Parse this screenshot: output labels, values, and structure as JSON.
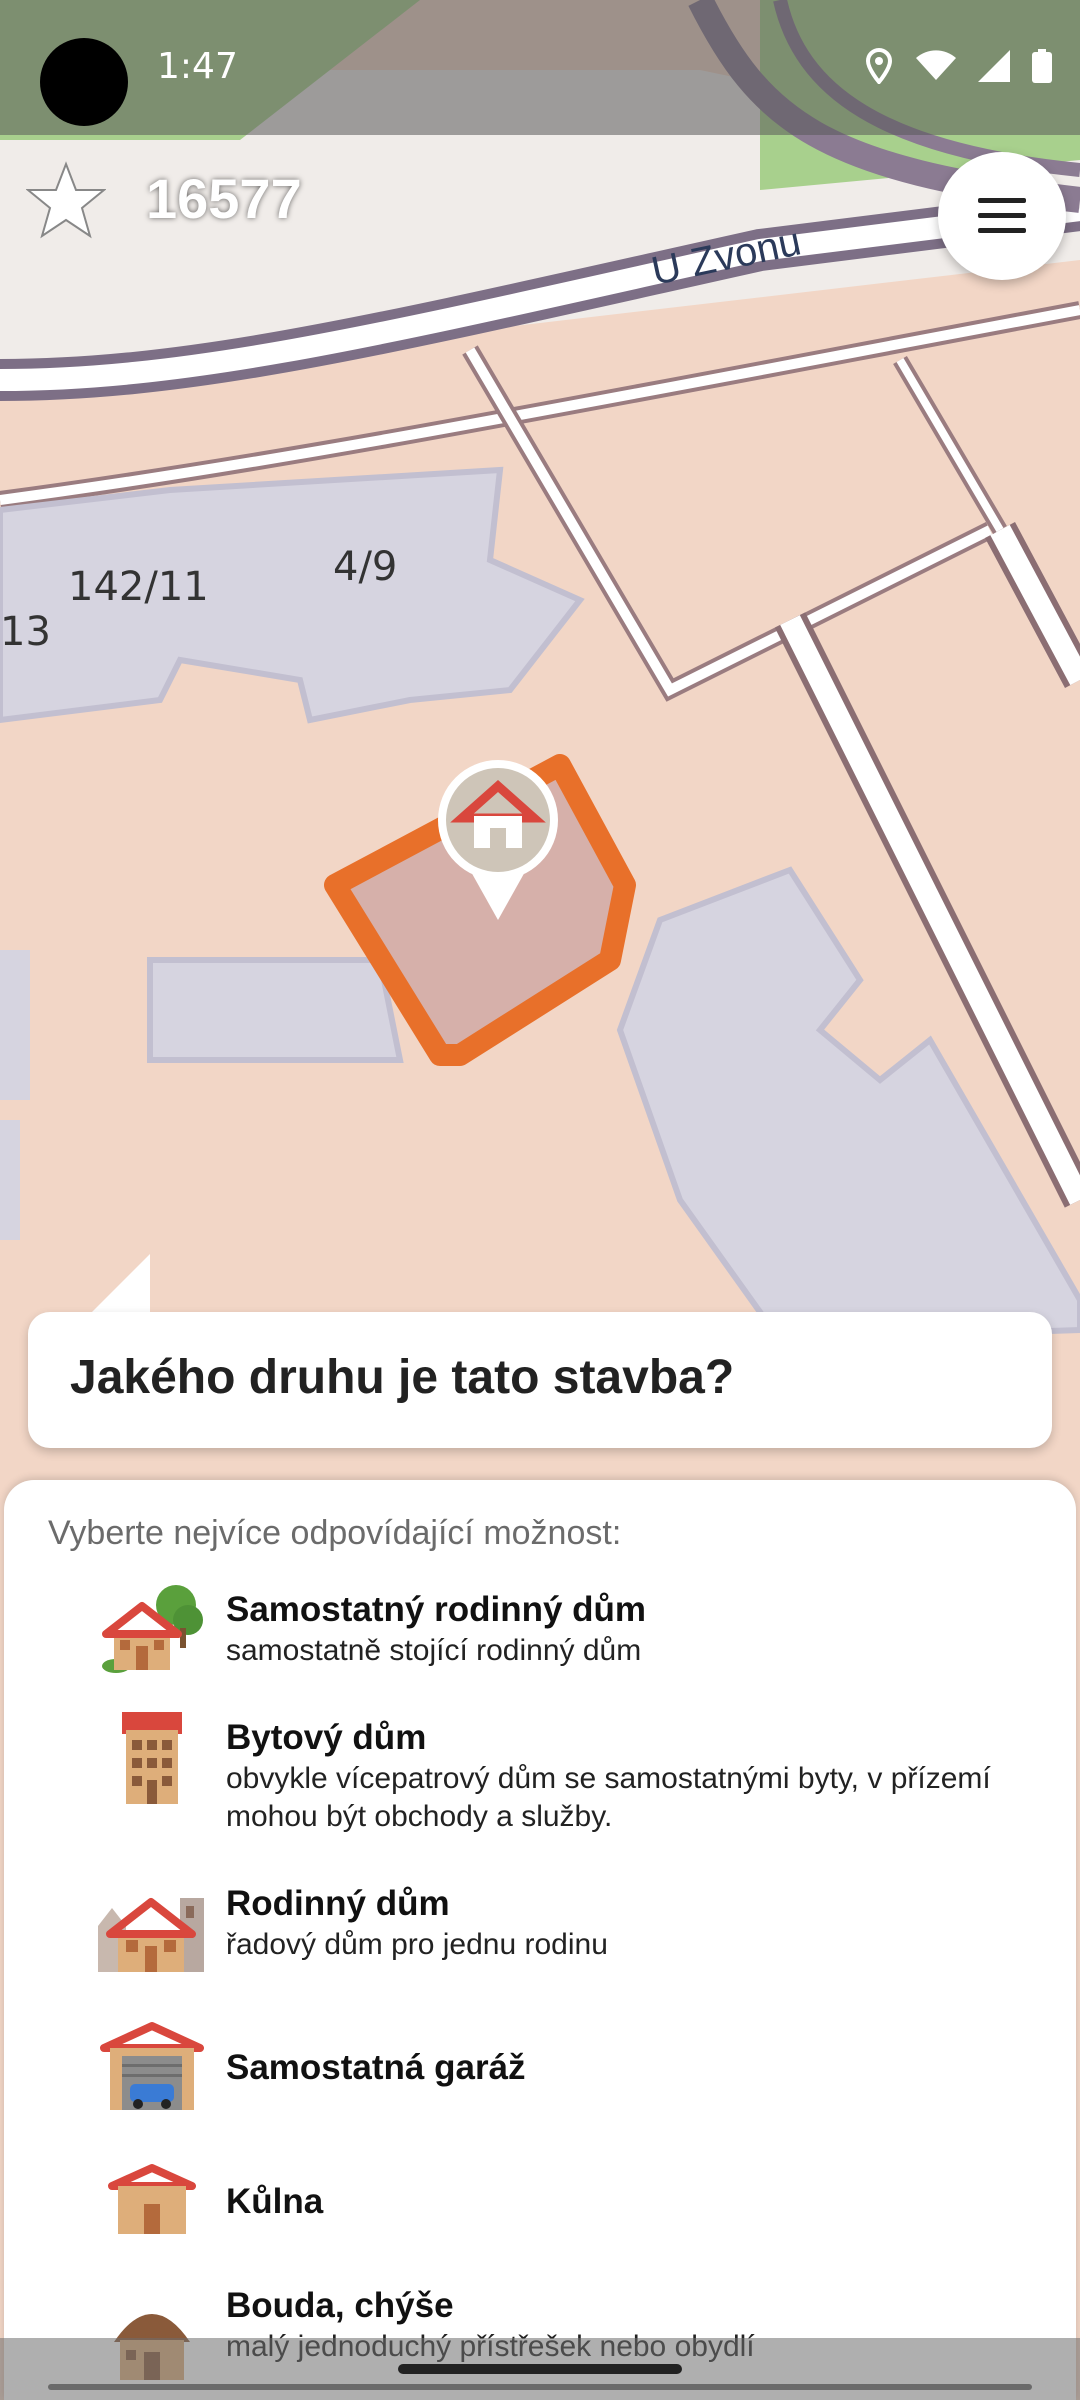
{
  "status_bar": {
    "time": "1:47"
  },
  "header": {
    "score": "16577"
  },
  "map": {
    "street_name": "U Zvonu",
    "house_numbers": [
      "142/11",
      "4/9",
      "13"
    ]
  },
  "quest": {
    "question": "Jakého druhu je tato stavba?",
    "hint": "Vyberte nejvíce odpovídající možnost:"
  },
  "options": [
    {
      "title": "Samostatný rodinný dům",
      "description": "samostatně stojící rodinný dům",
      "icon": "detached-house-icon"
    },
    {
      "title": "Bytový dům",
      "description": "obvykle vícepatrový dům se samostatnými byty, v přízemí mohou být obchody a služby.",
      "icon": "apartment-building-icon"
    },
    {
      "title": "Rodinný dům",
      "description": "řadový dům pro jednu rodinu",
      "icon": "terraced-house-icon"
    },
    {
      "title": "Samostatná garáž",
      "description": "",
      "icon": "garage-icon"
    },
    {
      "title": "Kůlna",
      "description": "",
      "icon": "shed-icon"
    },
    {
      "title": "Bouda, chýše",
      "description": "malý jednoduchý přístřešek nebo obydlí",
      "icon": "hut-icon"
    }
  ],
  "colors": {
    "building_highlight": "#e8702a",
    "map_land": "#f2d6c6",
    "map_buildings": "#d6d4e0",
    "map_green": "#a8d08d"
  }
}
